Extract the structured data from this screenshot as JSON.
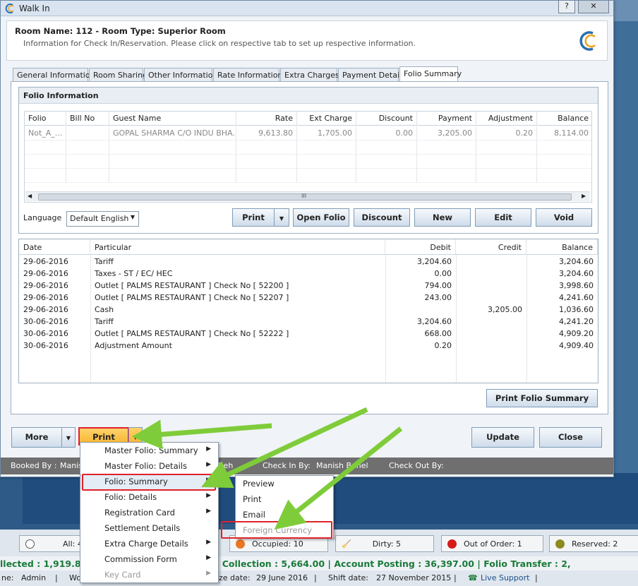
{
  "window": {
    "title": "Walk In",
    "help": "?",
    "close": "✕"
  },
  "header": {
    "room_line": "Room Name: 112 - Room Type: Superior Room",
    "info": "Information for Check In/Reservation. Please click on respective tab to set up respective information."
  },
  "tabs": [
    "General Information",
    "Room Sharing",
    "Other Information",
    "Rate Information",
    "Extra Charges",
    "Payment Details",
    "Folio Summary"
  ],
  "folio": {
    "title": "Folio Information",
    "columns": [
      "Folio",
      "Bill No",
      "Guest Name",
      "Rate",
      "Ext Charge",
      "Discount",
      "Payment",
      "Adjustment",
      "Balance"
    ],
    "row": [
      "Not_A_...",
      "",
      "GOPAL SHARMA C/O INDU BHA...",
      "9,613.80",
      "1,705.00",
      "0.00",
      "3,205.00",
      "0.20",
      "8,114.00"
    ],
    "scroll_grip": "III",
    "language_label": "Language",
    "language_value": "Default English",
    "buttons": {
      "print": "Print",
      "open_folio": "Open Folio",
      "discount": "Discount",
      "new": "New",
      "edit": "Edit",
      "void": "Void"
    }
  },
  "ledger": {
    "columns": [
      "Date",
      "Particular",
      "Debit",
      "Credit",
      "Balance"
    ],
    "rows": [
      [
        "29-06-2016",
        "Tariff",
        "3,204.60",
        "",
        "3,204.60"
      ],
      [
        "29-06-2016",
        "Taxes - ST / EC/ HEC",
        "0.00",
        "",
        "3,204.60"
      ],
      [
        "29-06-2016",
        "Outlet [ PALMS RESTAURANT ] Check No  [ 52200 ]",
        "794.00",
        "",
        "3,998.60"
      ],
      [
        "29-06-2016",
        "Outlet [ PALMS RESTAURANT ] Check No  [ 52207 ]",
        "243.00",
        "",
        "4,241.60"
      ],
      [
        "29-06-2016",
        "Cash",
        "",
        "3,205.00",
        "1,036.60"
      ],
      [
        "30-06-2016",
        "Tariff",
        "3,204.60",
        "",
        "4,241.20"
      ],
      [
        "30-06-2016",
        "Outlet [ PALMS RESTAURANT ] Check No  [ 52222 ]",
        "668.00",
        "",
        "4,909.20"
      ],
      [
        "30-06-2016",
        "Adjustment Amount",
        "0.20",
        "",
        "4,909.40"
      ]
    ],
    "print_summary": "Print Folio Summary"
  },
  "footer": {
    "more": "More",
    "print": "Print",
    "update": "Update",
    "close": "Close"
  },
  "statusbar": {
    "booked_by": "Booked By :",
    "booked_name": "Manis",
    "checkin_label": "Check In By:",
    "checkin_name": "Manish Behel",
    "checkout_label": "Check Out By:",
    "hidden_fragment": "Beh"
  },
  "print_menu": [
    {
      "label": "Master Folio: Summary",
      "sub": true,
      "disabled": false
    },
    {
      "label": "Master Folio: Details",
      "sub": true,
      "disabled": false
    },
    {
      "label": "Folio: Summary",
      "sub": true,
      "disabled": false
    },
    {
      "label": "Folio: Details",
      "sub": true,
      "disabled": false
    },
    {
      "label": "Registration Card",
      "sub": true,
      "disabled": false
    },
    {
      "label": "Settlement Details",
      "sub": false,
      "disabled": false
    },
    {
      "label": "Extra Charge Details",
      "sub": true,
      "disabled": false
    },
    {
      "label": "Commission Form",
      "sub": true,
      "disabled": false
    },
    {
      "label": "Key Card",
      "sub": true,
      "disabled": true
    }
  ],
  "submenu": [
    "Preview",
    "Print",
    "Email",
    "Foreign Currency"
  ],
  "room_status": {
    "all": "All: 49",
    "occupied": "Occupied: 10",
    "dirty": "Dirty: 5",
    "out_of_order": "Out of Order: 1",
    "reserved": "Reserved: 2"
  },
  "marquee": "llected : 1,919.84 | Bank Transfer : 0.00 | CC Collection : 5,664.00 | Account Posting : 36,397.00 | Folio Transfer : 2,",
  "bottom": {
    "user_label": "ne:",
    "user": "Admin",
    "wo": "Wo",
    "date_label": "ze date:",
    "date": "29 June 2016",
    "shift_label": "Shift date:",
    "shift": "27 November 2015",
    "support": "Live Support"
  },
  "colors": {
    "accent_green": "#7fcc3a",
    "highlight_red": "#e0222a",
    "print_orange": "#f7b431"
  }
}
